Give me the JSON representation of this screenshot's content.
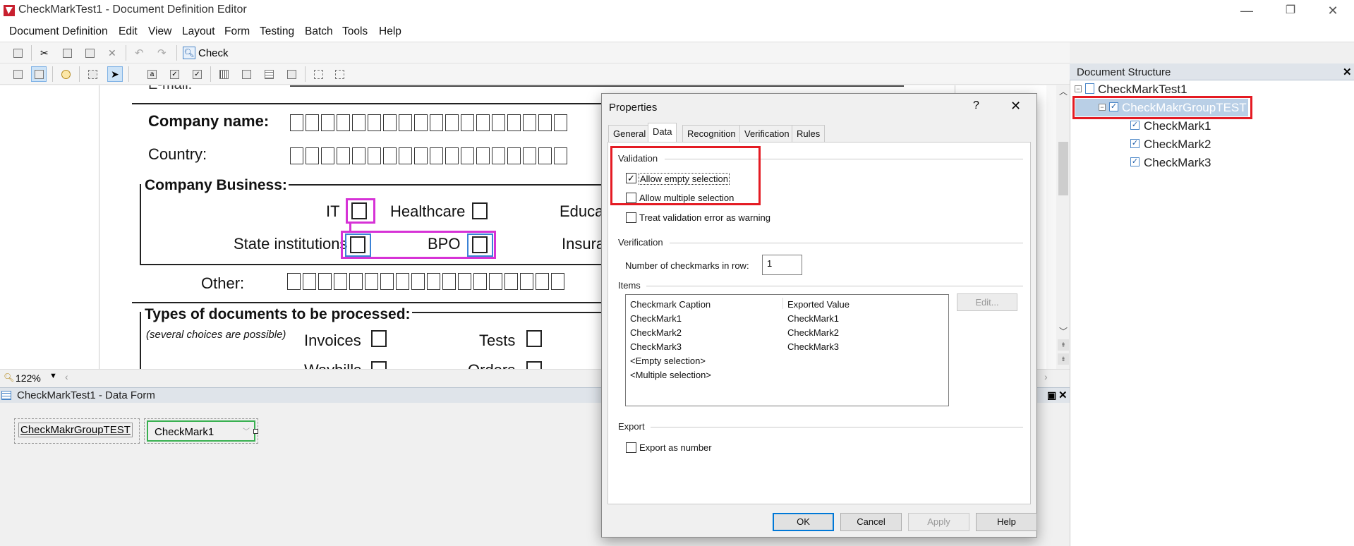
{
  "window": {
    "title": "CheckMarkTest1 - Document Definition Editor",
    "minimize": "—",
    "restore": "❐",
    "close": "✕"
  },
  "menu": [
    "Document Definition",
    "Edit",
    "View",
    "Layout",
    "Form",
    "Testing",
    "Batch",
    "Tools",
    "Help"
  ],
  "toolbar1": {
    "check_label": "Check"
  },
  "canvas": {
    "email_label": "E-mail:",
    "company_name": "Company name:",
    "country": "Country:",
    "company_business": "Company Business:",
    "it": "IT",
    "healthcare": "Healthcare",
    "education": "Educat",
    "state_institutions": "State institutions",
    "bpo": "BPO",
    "insurance": "Insuran",
    "other": "Other:",
    "types_title": "Types of documents to be processed:",
    "several": "(several choices are possible)",
    "invoices": "Invoices",
    "tests": "Tests",
    "waybills": "Waybills",
    "orders": "Orders"
  },
  "zoom": {
    "value": "122%"
  },
  "data_form": {
    "title": "CheckMarkTest1 - Data Form",
    "group_label": "CheckMakrGroupTEST",
    "combo_value": "CheckMark1"
  },
  "doc_structure": {
    "title": "Document Structure",
    "close": "✕",
    "root": "CheckMarkTest1",
    "group": "CheckMakrGroupTEST",
    "items": [
      "CheckMark1",
      "CheckMark2",
      "CheckMark3"
    ]
  },
  "dialog": {
    "title": "Properties",
    "help": "?",
    "close": "✕",
    "tabs": [
      "General",
      "Data",
      "Recognition",
      "Verification",
      "Rules"
    ],
    "active_tab": "Data",
    "validation_group": "Validation",
    "allow_empty": "Allow empty selection",
    "allow_empty_checked": true,
    "allow_multiple": "Allow multiple selection",
    "allow_multiple_checked": false,
    "treat_warning": "Treat validation error as warning",
    "treat_warning_checked": false,
    "verification_group": "Verification",
    "checkmarks_in_row_label": "Number of checkmarks in row:",
    "checkmarks_in_row_value": "1",
    "items_group": "Items",
    "items_columns": [
      "Checkmark Caption",
      "Exported Value"
    ],
    "items_rows": [
      [
        "CheckMark1",
        "CheckMark1"
      ],
      [
        "CheckMark2",
        "CheckMark2"
      ],
      [
        "CheckMark3",
        "CheckMark3"
      ],
      [
        "<Empty selection>",
        ""
      ],
      [
        "<Multiple selection>",
        ""
      ]
    ],
    "edit_button": "Edit...",
    "export_group": "Export",
    "export_as_number": "Export as number",
    "export_as_number_checked": false,
    "ok": "OK",
    "cancel": "Cancel",
    "apply": "Apply",
    "help_button": "Help"
  }
}
